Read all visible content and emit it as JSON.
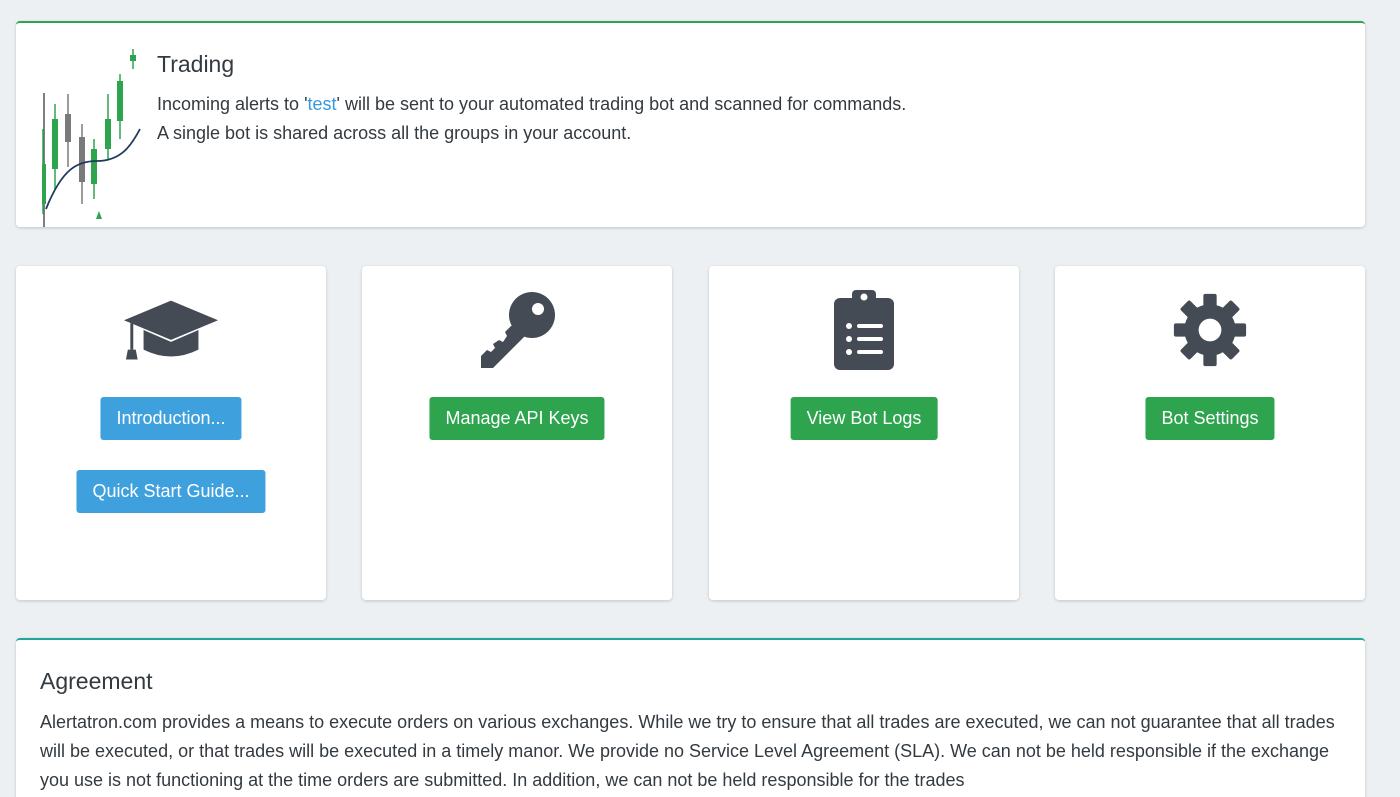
{
  "trading": {
    "title": "Trading",
    "line1_prefix": "Incoming alerts to '",
    "group_name": "test",
    "line1_suffix": "' will be sent to your automated trading bot and scanned for commands.",
    "line2": "A single bot is shared across all the groups in your account."
  },
  "tiles": {
    "intro": {
      "icon": "graduation-cap-icon",
      "button1": "Introduction...",
      "button2": "Quick Start Guide..."
    },
    "keys": {
      "icon": "key-icon",
      "button": "Manage API Keys"
    },
    "logs": {
      "icon": "clipboard-list-icon",
      "button": "View Bot Logs"
    },
    "settings": {
      "icon": "gear-icon",
      "button": "Bot Settings"
    }
  },
  "agreement": {
    "title": "Agreement",
    "text": "Alertatron.com provides a means to execute orders on various exchanges. While we try to ensure that all trades are executed, we can not guarantee that all trades will be executed, or that trades will be executed in a timely manor. We provide no Service Level Agreement (SLA). We can not be held responsible if the exchange you use is not functioning at the time orders are submitted. In addition, we can not be held responsible for the trades"
  },
  "colors": {
    "background": "#edf0f2",
    "blue_button": "#3ea1de",
    "green_button": "#2ea44f",
    "link": "#3498db",
    "icon": "#444b54",
    "candle_green": "#2ea44f",
    "candle_gray": "#7a7a7a"
  }
}
